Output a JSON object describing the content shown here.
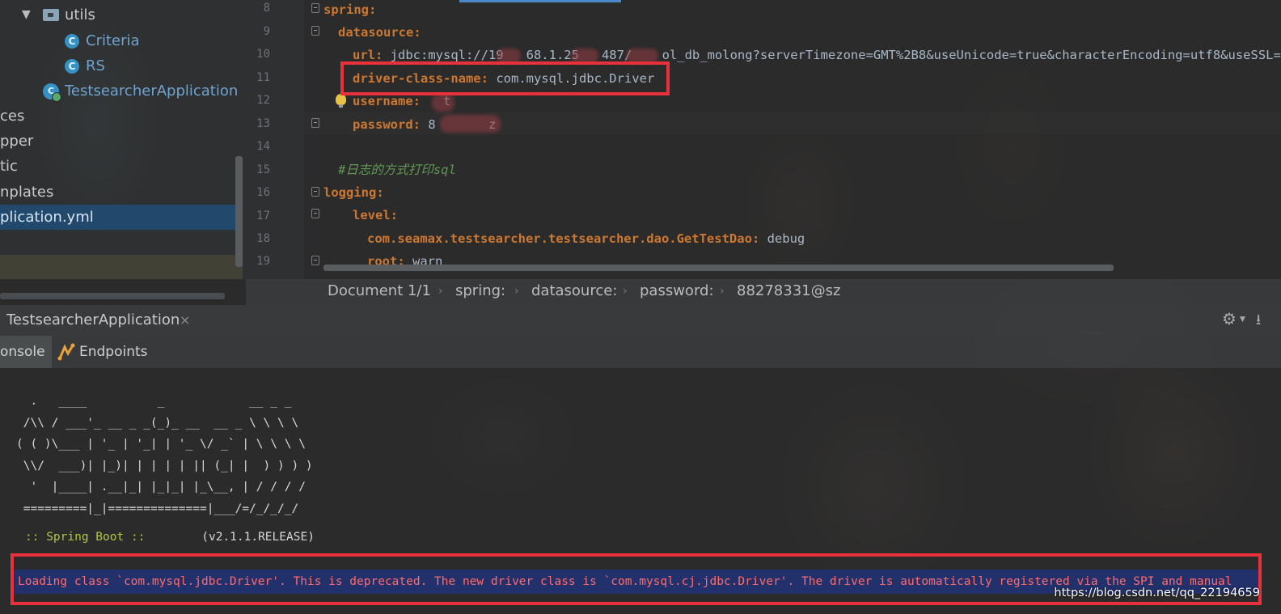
{
  "project_tree": {
    "items": [
      {
        "label": "utils",
        "kind": "folder"
      },
      {
        "label": "Criteria",
        "kind": "class"
      },
      {
        "label": "RS",
        "kind": "class"
      },
      {
        "label": "TestsearcherApplication",
        "kind": "app"
      },
      {
        "label": "ces",
        "kind": "folder-partial"
      },
      {
        "label": "pper",
        "kind": "folder-partial"
      },
      {
        "label": "tic",
        "kind": "folder-partial"
      },
      {
        "label": "nplates",
        "kind": "folder-partial"
      },
      {
        "label": "plication.yml",
        "kind": "file-selected"
      }
    ]
  },
  "editor": {
    "line_numbers": [
      "8",
      "9",
      "10",
      "11",
      "12",
      "13",
      "14",
      "15",
      "16",
      "17",
      "18",
      "19"
    ],
    "lines": [
      {
        "key": "spring:",
        "value": ""
      },
      {
        "key": "datasource:",
        "value": ""
      },
      {
        "key": "url:",
        "value": " jdbc:mysql://19   68.1.25   487/    ol_db_molong?serverTimezone=GMT%2B8&useUnicode=true&characterEncoding=utf8&useSSL=false"
      },
      {
        "key": "driver-class-name:",
        "value": " com.mysql.jdbc.Driver"
      },
      {
        "key": "username:",
        "value": "   t"
      },
      {
        "key": "password:",
        "value": " 8       z"
      },
      {
        "key": "",
        "value": ""
      },
      {
        "comment": "#日志的方式打印sql"
      },
      {
        "key": "logging:",
        "value": ""
      },
      {
        "key": "level:",
        "value": ""
      },
      {
        "key": "com.seamax.testsearcher.testsearcher.dao.GetTestDao:",
        "value": " debug"
      },
      {
        "key": "root:",
        "value": " warn"
      }
    ]
  },
  "breadcrumb": {
    "items": [
      "Document 1/1",
      "spring:",
      "datasource:",
      "password:",
      "88278331@sz"
    ]
  },
  "run_window": {
    "tab_label": "TestsearcherApplication",
    "close_glyph": "×",
    "console_tab": "onsole",
    "endpoints_tab": "Endpoints"
  },
  "console": {
    "banner": "  .   ____          _            __ _ _\n /\\\\ / ___'_ __ _ _(_)_ __  __ _ \\ \\ \\ \\\n( ( )\\___ | '_ | '_| | '_ \\/ _` | \\ \\ \\ \\\n \\\\/  ___)| |_)| | | | | || (_| |  ) ) ) )\n  '  |____| .__|_| |_|_| |_\\__, | / / / /\n =========|_|==============|___/=/_/_/_/",
    "spring_boot_label": ":: Spring Boot ::",
    "spring_boot_version": "        (v2.1.1.RELEASE)",
    "warning": "Loading class `com.mysql.jdbc.Driver'. This is deprecated. The new driver class is `com.mysql.cj.jdbc.Driver'. The driver is automatically registered via the SPI and manual"
  },
  "watermark": "https://blog.csdn.net/qq_22194659",
  "colors": {
    "key": "#cc7832",
    "value": "#a9b7c6",
    "comment": "#629755",
    "highlight_box": "#e8313b",
    "warning_text": "#ff6b6b",
    "selection": "#204c76"
  }
}
